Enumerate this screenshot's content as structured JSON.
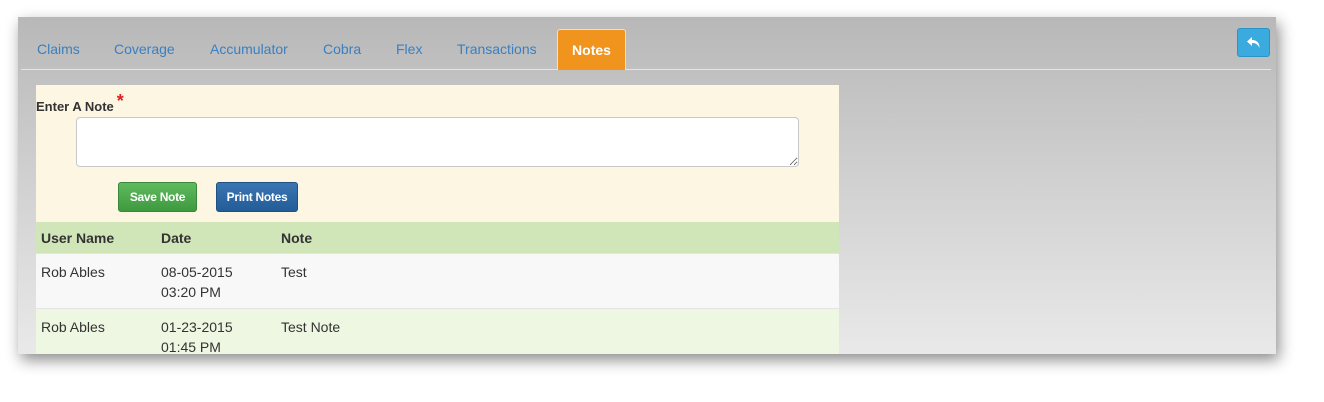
{
  "tabs": [
    {
      "label": "Claims",
      "active": false
    },
    {
      "label": "Coverage",
      "active": false
    },
    {
      "label": "Accumulator",
      "active": false
    },
    {
      "label": "Cobra",
      "active": false
    },
    {
      "label": "Flex",
      "active": false
    },
    {
      "label": "Transactions",
      "active": false
    },
    {
      "label": "Notes",
      "active": true
    }
  ],
  "back_button": {
    "icon": "reply-arrow-icon",
    "color": "#3aaadf"
  },
  "note_form": {
    "label": "Enter A Note",
    "required_marker": "*",
    "value": "",
    "save_label": "Save Note",
    "print_label": "Print Notes"
  },
  "notes_table": {
    "columns": [
      "User Name",
      "Date",
      "Note"
    ],
    "rows": [
      {
        "user": "Rob Ables",
        "date": "08-05-2015",
        "time": "03:20 PM",
        "note": "Test"
      },
      {
        "user": "Rob Ables",
        "date": "01-23-2015",
        "time": "01:45 PM",
        "note": "Test Note"
      }
    ]
  },
  "colors": {
    "active_tab": "#f0941e",
    "tab_text": "#3a7fc1",
    "save_button": "#4cae4c",
    "print_button": "#2c6aa8",
    "table_header": "#d0e6b8",
    "form_background": "#fdf6e3"
  }
}
